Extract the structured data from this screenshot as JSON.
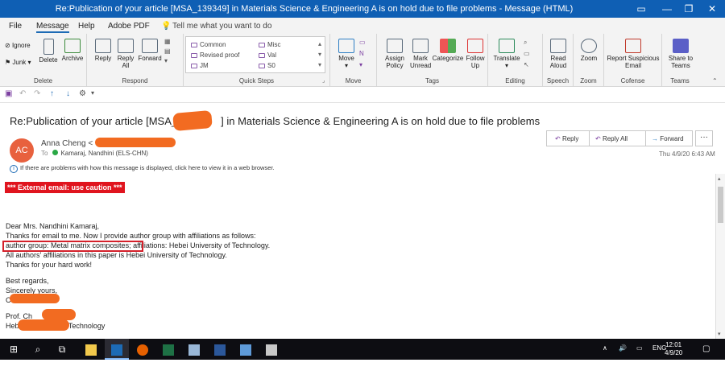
{
  "window": {
    "title": "Re:Publication of your article [MSA_139349] in Materials Science & Engineering A is on hold due to file problems - Message (HTML)"
  },
  "menu": {
    "items": [
      "File",
      "Message",
      "Help",
      "Adobe PDF"
    ],
    "tellme": "Tell me what you want to do"
  },
  "ribbon": {
    "delete": {
      "ignore": "Ignore",
      "junk": "Junk",
      "delete": "Delete",
      "archive": "Archive",
      "label": "Delete"
    },
    "respond": {
      "reply": "Reply",
      "reply_all": "Reply All",
      "forward": "Forward",
      "label": "Respond"
    },
    "quicksteps": {
      "items": [
        "Common",
        "Misc",
        "Revised proof",
        "Val",
        "JM",
        "S0"
      ],
      "label": "Quick Steps"
    },
    "move": {
      "move": "Move",
      "label": "Move"
    },
    "tags": {
      "assign_policy": "Assign Policy",
      "mark_unread": "Mark Unread",
      "categorize": "Categorize",
      "follow_up": "Follow Up",
      "label": "Tags"
    },
    "editing": {
      "translate": "Translate",
      "label": "Editing"
    },
    "speech": {
      "read_aloud": "Read Aloud",
      "label": "Speech"
    },
    "zoom": {
      "zoom": "Zoom",
      "label": "Zoom"
    },
    "cofense": {
      "report": "Report Suspicious Email",
      "label": "Cofense"
    },
    "teams": {
      "share": "Share to Teams",
      "label": "Teams"
    }
  },
  "message": {
    "subject_prefix": "Re:Publication of your article [MSA_",
    "subject_suffix": "] in Materials Science & Engineering A is on hold due to file problems",
    "avatar": "AC",
    "sender": "Anna Cheng <",
    "to_label": "To",
    "recipient": "Kamaraj, Nandhini (ELS-CHN)",
    "date": "Thu 4/9/20 6:43 AM",
    "info": "If there are problems with how this message is displayed, click here to view it in a web browser.",
    "actions": {
      "reply": "Reply",
      "reply_all": "Reply All",
      "forward": "Forward",
      "more": "···"
    }
  },
  "body": {
    "warning": "*** External email: use caution ***",
    "lines": [
      "Dear Mrs. Nandhini Kamaraj,",
      "Thanks for email to me. Now I provide author group with affiliations as follows:",
      "author group: Metal matrix composites; affiliations: Hebei University of Technology.",
      "All authors' affiliations in this paper is Hebei University of Technology.",
      "Thanks for your hard work!",
      "Best regards,",
      "Sincerely yours,",
      "C",
      "Prof. Ch",
      "Hebei University of Technology"
    ]
  },
  "taskbar": {
    "time": "12:01",
    "date": "4/9/20",
    "lang": "ENG"
  }
}
